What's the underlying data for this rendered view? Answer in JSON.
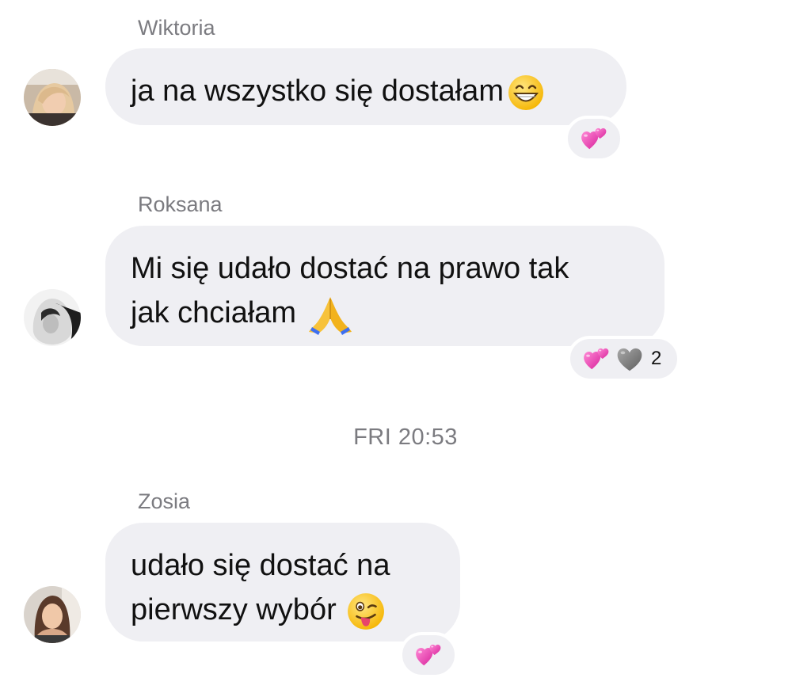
{
  "messages": [
    {
      "sender": "Wiktoria",
      "lines": [
        "ja na wszystko się dostałam"
      ],
      "emoji": "grinning-face-with-smiling-eyes",
      "reactions": [
        "two-hearts"
      ],
      "reaction_count": ""
    },
    {
      "sender": "Roksana",
      "lines": [
        "Mi się udało dostać na prawo tak",
        "jak chciałam"
      ],
      "emoji": "folded-hands",
      "reactions": [
        "two-hearts",
        "grey-heart"
      ],
      "reaction_count": "2"
    },
    {
      "sender": "Zosia",
      "lines": [
        "udało się dostać na",
        "pierwszy wybór"
      ],
      "emoji": "winking-face-with-tongue",
      "reactions": [
        "two-hearts"
      ],
      "reaction_count": ""
    }
  ],
  "timestamp": "FRI 20:53",
  "colors": {
    "bubble_bg": "#efeff3",
    "name_text": "#7b7b80",
    "message_text": "#111111",
    "heart_pink": "#e94fb7",
    "heart_grey": "#8a8a8a"
  }
}
